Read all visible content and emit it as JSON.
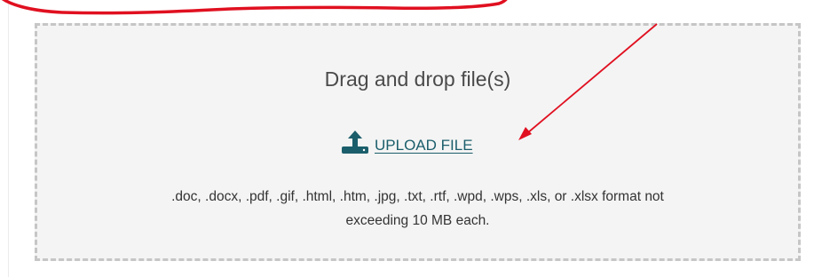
{
  "dropzone": {
    "title": "Drag and drop file(s)",
    "upload_icon": "upload-icon",
    "upload_label": "UPLOAD FILE",
    "format_line1": ".doc, .docx, .pdf, .gif, .html, .htm, .jpg, .txt, .rtf, .wpd, .wps, .xls, or .xlsx format not",
    "format_line2": "exceeding 10 MB each."
  },
  "colors": {
    "link": "#1b5e6b",
    "annotation": "#e01020",
    "dropzone_bg": "#f4f4f4",
    "dropzone_border": "#c6c6c6"
  }
}
